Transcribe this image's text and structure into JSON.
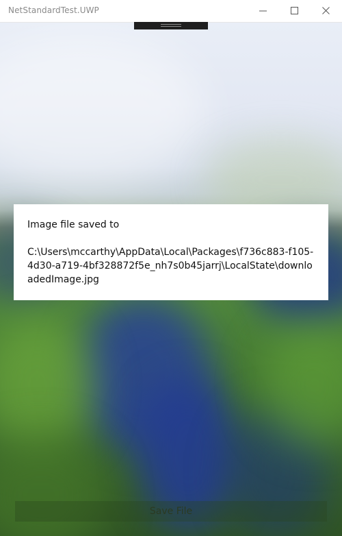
{
  "window": {
    "title": "NetStandardTest.UWP"
  },
  "titlebar": {
    "buttons": [
      "minimize-icon",
      "maximize-icon",
      "close-icon"
    ]
  },
  "dialog": {
    "message": "Image file saved to\n\nC:\\Users\\mccarthy\\AppData\\Local\\Packages\\f736c883-f105-4d30-a719-4bf328872f5e_nh7s0b45jarrj\\LocalState\\downloadedImage.jpg"
  },
  "actions": {
    "save_label": "Save File"
  },
  "colors": {
    "titlebar_bg": "#ffffff",
    "title_text": "#8a8a8a",
    "dialog_bg": "#ffffff",
    "button_bg": "#4a6a3a"
  }
}
